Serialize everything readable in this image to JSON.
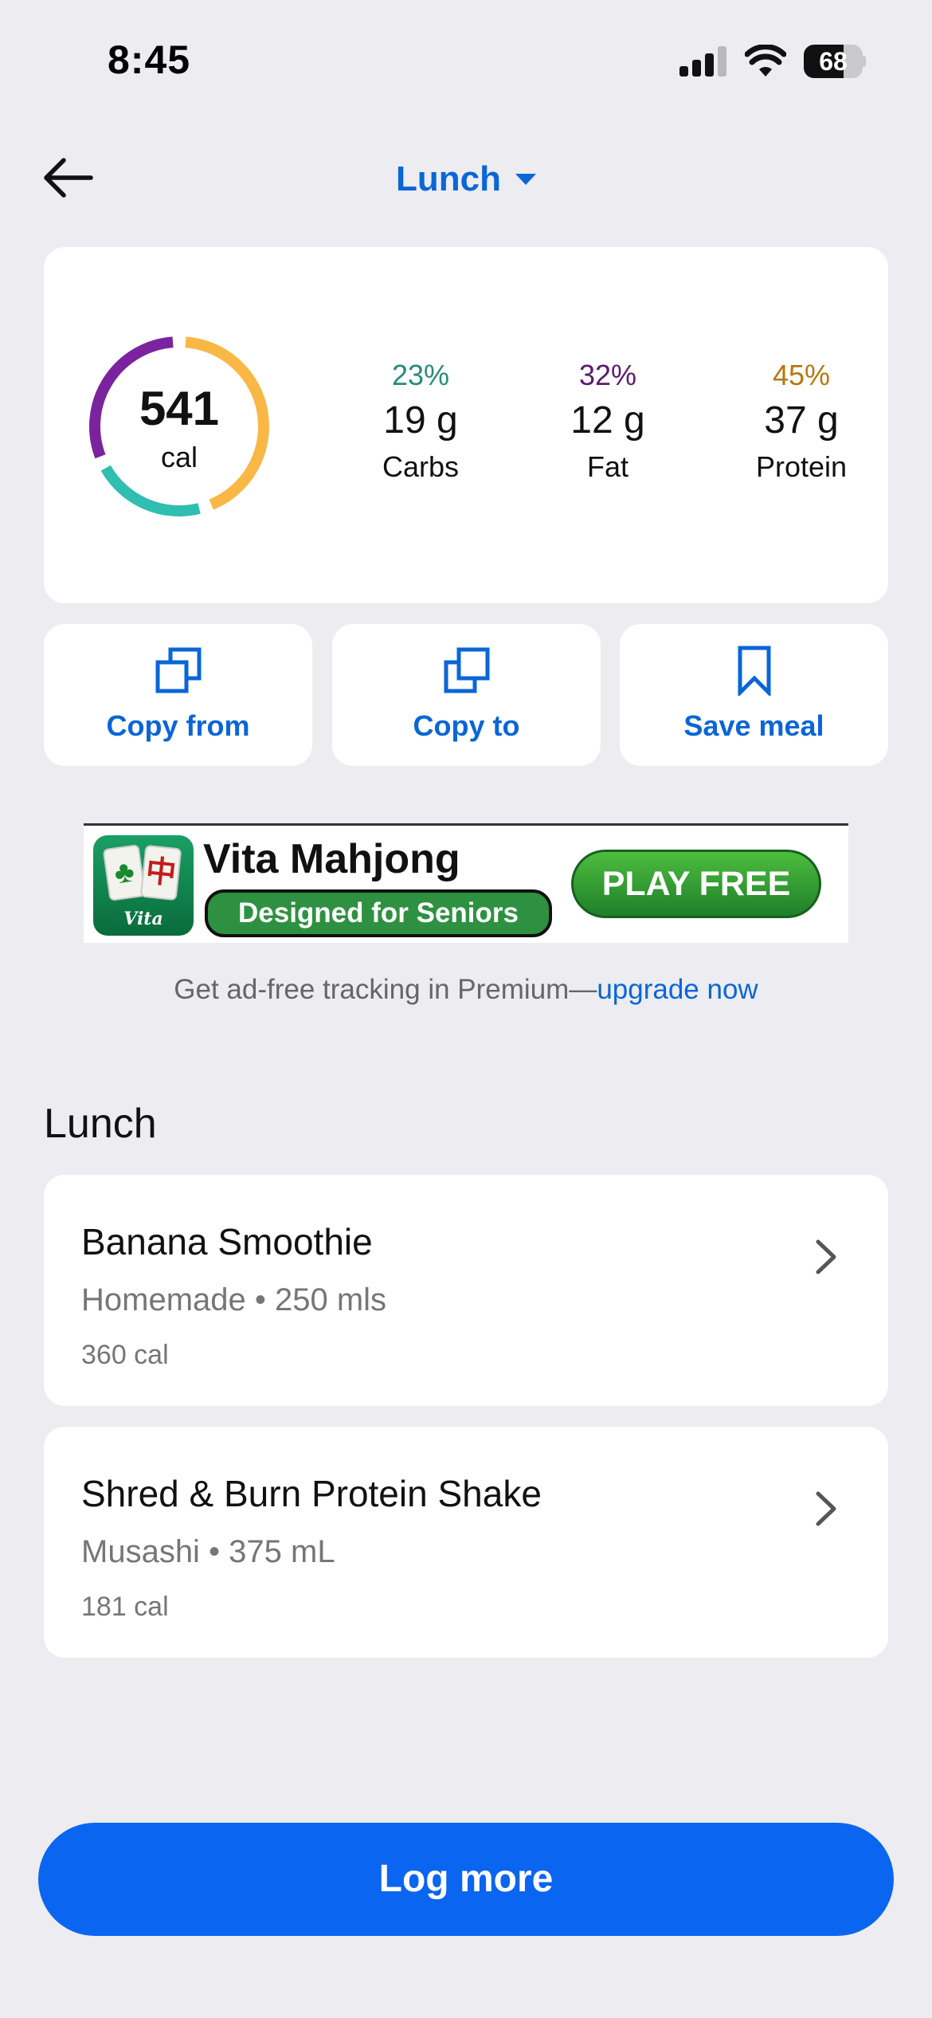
{
  "status_bar": {
    "time": "8:45",
    "battery": "68",
    "battery_level": 0.68
  },
  "header": {
    "meal": "Lunch"
  },
  "summary": {
    "calories": "541",
    "calories_unit": "cal",
    "macros": [
      {
        "pct": "23%",
        "value": "19 g",
        "name": "Carbs",
        "color": "#2a8a7a",
        "ring_color": "#2fbeb0",
        "fraction": 0.23
      },
      {
        "pct": "32%",
        "value": "12 g",
        "name": "Fat",
        "color": "#5a1b6e",
        "ring_color": "#7b239e",
        "fraction": 0.32
      },
      {
        "pct": "45%",
        "value": "37 g",
        "name": "Protein",
        "color": "#b8760f",
        "ring_color": "#f9b846",
        "fraction": 0.45
      }
    ]
  },
  "actions": {
    "copy_from": "Copy from",
    "copy_to": "Copy to",
    "save_meal": "Save meal"
  },
  "ad": {
    "title": "Vita Mahjong",
    "tagline": "Designed for Seniors",
    "cta": "PLAY FREE",
    "icon_label": "Vita"
  },
  "premium": {
    "text": "Get ad-free tracking in Premium—",
    "link": "upgrade now"
  },
  "section_title": "Lunch",
  "foods": [
    {
      "name": "Banana Smoothie",
      "detail": "Homemade • 250 mls",
      "calories": "360 cal"
    },
    {
      "name": "Shred & Burn Protein Shake",
      "detail": "Musashi • 375 mL",
      "calories": "181 cal"
    }
  ],
  "log_more": "Log more",
  "colors": {
    "accent": "#0a66d6",
    "button": "#0a66f0",
    "background": "#ececf1"
  }
}
